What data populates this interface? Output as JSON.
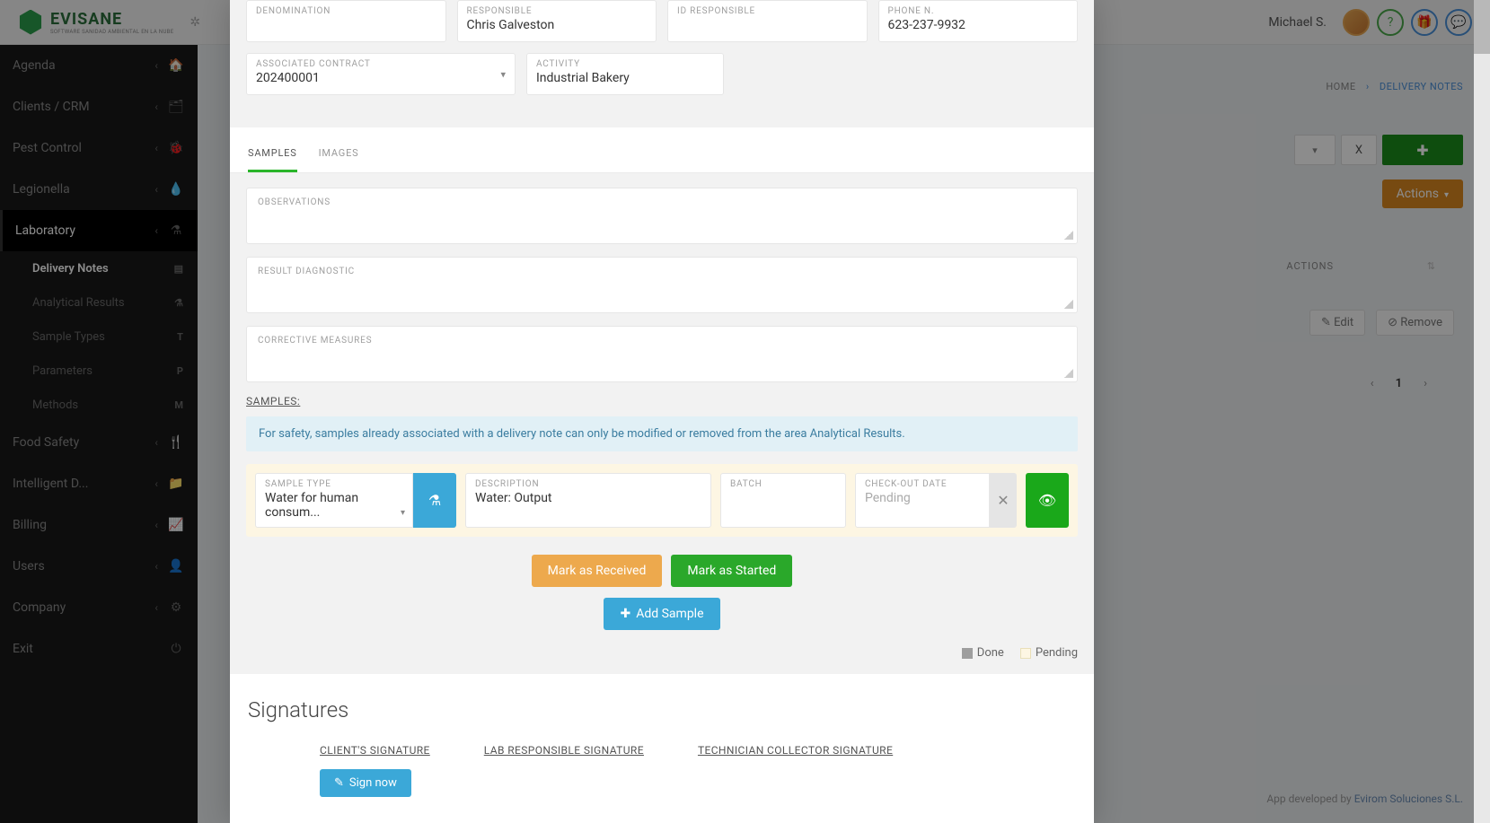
{
  "brand": {
    "name": "EVISANE",
    "tagline": "SOFTWARE SANIDAD AMBIENTAL EN LA NUBE"
  },
  "user": {
    "name": "Michael S."
  },
  "breadcrumb": {
    "home": "HOME",
    "current": "DELIVERY NOTES"
  },
  "sidebar": {
    "items": [
      {
        "label": "Agenda",
        "icon": "🏠"
      },
      {
        "label": "Clients / CRM",
        "icon": "🗂"
      },
      {
        "label": "Pest Control",
        "icon": "🐞"
      },
      {
        "label": "Legionella",
        "icon": "💧"
      },
      {
        "label": "Laboratory",
        "icon": "⚗"
      },
      {
        "label": "Food Safety",
        "icon": "🍴"
      },
      {
        "label": "Intelligent D...",
        "icon": "📁"
      },
      {
        "label": "Billing",
        "icon": "📈"
      },
      {
        "label": "Users",
        "icon": "👤"
      },
      {
        "label": "Company",
        "icon": "⚙"
      },
      {
        "label": "Exit",
        "icon": "⏻"
      }
    ],
    "sub": [
      {
        "label": "Delivery Notes",
        "badge": "▤"
      },
      {
        "label": "Analytical Results",
        "badge": "⚗"
      },
      {
        "label": "Sample Types",
        "badge": "T"
      },
      {
        "label": "Parameters",
        "badge": "P"
      },
      {
        "label": "Methods",
        "badge": "M"
      }
    ]
  },
  "bgpage": {
    "actions_btn": "Actions",
    "thead_actions": "ACTIONS",
    "edit": "Edit",
    "remove": "Remove",
    "page": "1",
    "footer_pre": "App developed by ",
    "footer_link": "Evirom Soluciones S.L."
  },
  "form": {
    "row1": [
      {
        "label": "DENOMINATION",
        "value": ""
      },
      {
        "label": "RESPONSIBLE",
        "value": "Chris Galveston"
      },
      {
        "label": "ID RESPONSIBLE",
        "value": ""
      },
      {
        "label": "PHONE N.",
        "value": "623-237-9932"
      }
    ],
    "row2": [
      {
        "label": "ASSOCIATED CONTRACT",
        "value": "202400001",
        "drop": true
      },
      {
        "label": "ACTIVITY",
        "value": "Industrial Bakery"
      }
    ]
  },
  "tabs": {
    "samples": "SAMPLES",
    "images": "IMAGES"
  },
  "samples": {
    "observations_lbl": "OBSERVATIONS",
    "result_lbl": "RESULT DIAGNOSTIC",
    "corrective_lbl": "CORRECTIVE MEASURES",
    "header": "SAMPLES:",
    "info": "For safety, samples already associated with a delivery note can only be modified or removed from the area Analytical Results.",
    "row": {
      "type_lbl": "SAMPLE TYPE",
      "type_val": "Water for human consum...",
      "desc_lbl": "DESCRIPTION",
      "desc_val": "Water: Output",
      "batch_lbl": "BATCH",
      "batch_val": "",
      "date_lbl": "CHECK-OUT DATE",
      "date_val": "Pending"
    },
    "btn_received": "Mark as Received",
    "btn_started": "Mark as Started",
    "btn_add": "Add Sample",
    "leg_done": "Done",
    "leg_pending": "Pending"
  },
  "signatures": {
    "title": "Signatures",
    "client": "CLIENT'S SIGNATURE",
    "lab": "LAB RESPONSIBLE SIGNATURE",
    "tech": "TECHNICIAN COLLECTOR SIGNATURE",
    "sign_now": "Sign now"
  }
}
